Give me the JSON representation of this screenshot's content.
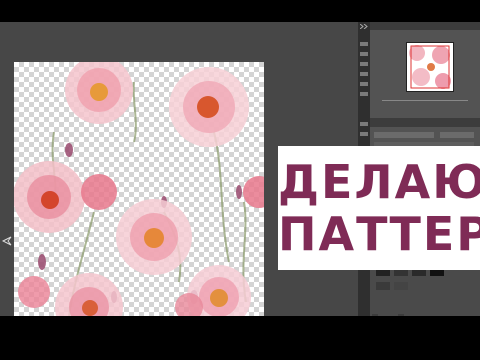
{
  "banner": {
    "line1": "ДЕЛАЮ",
    "line2": "ПАТТЕРН",
    "text_color": "#7f2b56",
    "background": "#ffffff"
  },
  "editor": {
    "workspace_color": "#474747",
    "panel_color": "#535353",
    "canvas_transparency": "checkerboard"
  },
  "icons": [
    "move-cursor-icon",
    "collapse-arrows-icon"
  ]
}
